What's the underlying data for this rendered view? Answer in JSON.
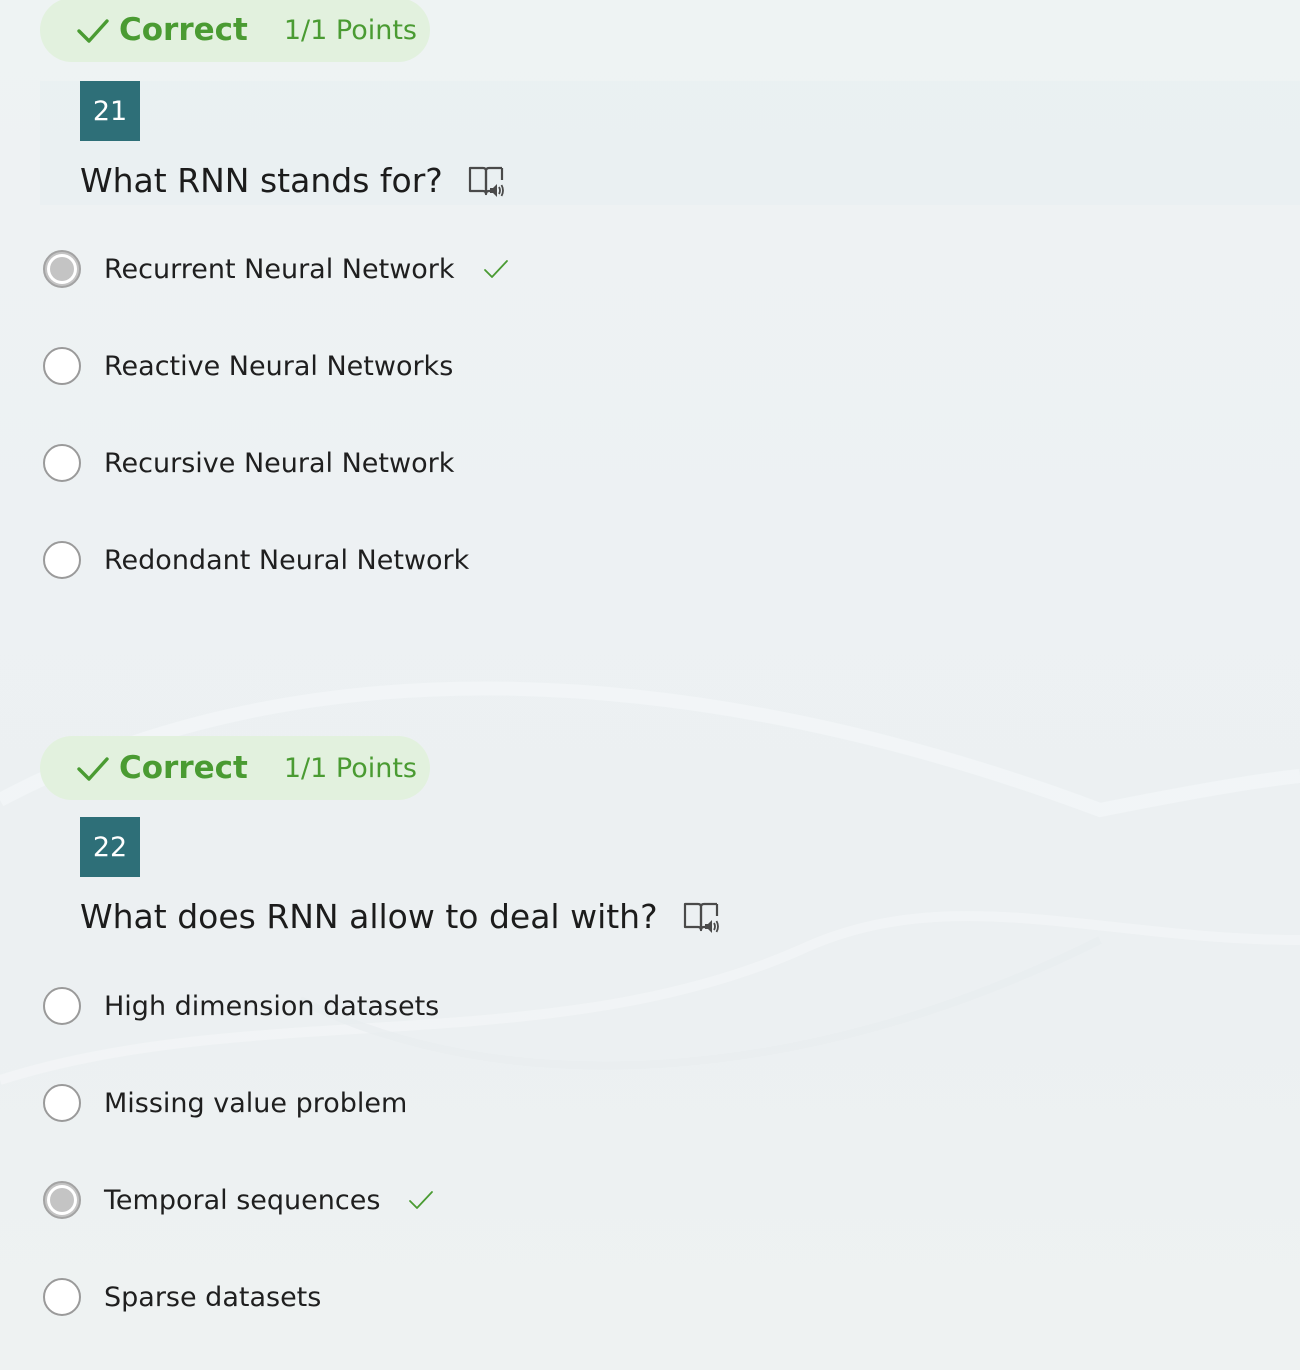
{
  "colors": {
    "correct_green": "#4a9b32",
    "pill_background": "#e2f1de",
    "number_badge": "#2e6f78"
  },
  "questions": [
    {
      "status": {
        "label": "Correct",
        "points": "1/1 Points",
        "icon": "checkmark-icon"
      },
      "number": "21",
      "text": "What RNN stands for?",
      "reader_icon": "immersive-reader-icon",
      "options": [
        {
          "label": "Recurrent Neural Network",
          "selected": true,
          "correct": true
        },
        {
          "label": "Reactive Neural Networks",
          "selected": false,
          "correct": false
        },
        {
          "label": "Recursive Neural Network",
          "selected": false,
          "correct": false
        },
        {
          "label": "Redondant Neural Network",
          "selected": false,
          "correct": false
        }
      ]
    },
    {
      "status": {
        "label": "Correct",
        "points": "1/1 Points",
        "icon": "checkmark-icon"
      },
      "number": "22",
      "text": "What does RNN allow to deal with?",
      "reader_icon": "immersive-reader-icon",
      "options": [
        {
          "label": "High dimension datasets",
          "selected": false,
          "correct": false
        },
        {
          "label": "Missing value problem",
          "selected": false,
          "correct": false
        },
        {
          "label": "Temporal sequences",
          "selected": true,
          "correct": true
        },
        {
          "label": "Sparse datasets",
          "selected": false,
          "correct": false
        }
      ]
    }
  ]
}
